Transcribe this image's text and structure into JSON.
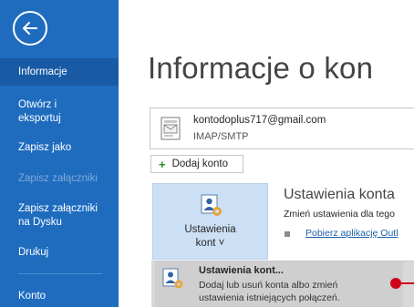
{
  "sidebar": {
    "back_icon": "back-arrow-icon",
    "items": [
      {
        "label": "Informacje",
        "active": true
      },
      {
        "label": "Otwórz i",
        "label2": "eksportuj"
      },
      {
        "label": "Zapisz jako"
      },
      {
        "label": "Zapisz załączniki",
        "disabled": true
      },
      {
        "label": "Zapisz załączniki",
        "label2": "na Dysku"
      },
      {
        "label": "Drukuj"
      },
      {
        "label": "Konto"
      }
    ]
  },
  "main": {
    "title": "Informacje o kon",
    "account": {
      "email": "kontodoplus717@gmail.com",
      "type": "IMAP/SMTP"
    },
    "add_account_label": "Dodaj konto",
    "settings_button": {
      "label_line1": "Ustawienia",
      "label_line2": "kont ˅"
    },
    "section": {
      "title": "Ustawienia konta",
      "description": "Zmień ustawienia dla tego",
      "link": "Pobierz aplikację Outl"
    },
    "dropdown": {
      "title": "Ustawienia kont...",
      "desc_line1": "Dodaj lub usuń konta albo zmień",
      "desc_line2": "ustawienia istniejących połączeń."
    }
  },
  "colors": {
    "sidebar": "#1f6cbf",
    "sidebar_active": "#185aa4",
    "button_highlight": "#cce0f5",
    "link": "#1e5fa8",
    "annotation": "#d0021b"
  }
}
